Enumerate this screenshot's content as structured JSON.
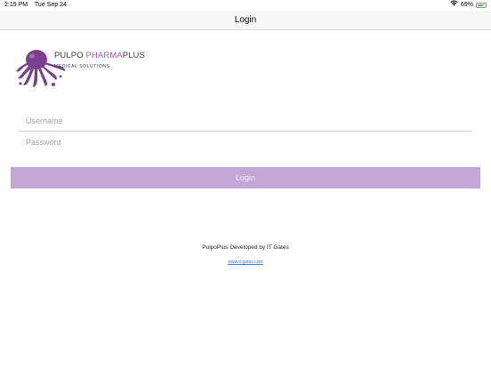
{
  "status_bar": {
    "time": "2:19 PM",
    "date": "Tue Sep 24",
    "battery_percent_label": "69%",
    "battery_level": 0.69,
    "wifi_icon": "wifi-icon",
    "battery_icon": "battery-icon"
  },
  "nav": {
    "title": "Login"
  },
  "logo": {
    "icon": "octopus-logo",
    "brand_part1": "PULPO ",
    "brand_part2": "PHARMA",
    "brand_part3": "PLUS",
    "tagline": "MEDICAL SOLUTIONS",
    "colors": {
      "octopus": "#7b3f8f",
      "accent": "#9b59b6"
    }
  },
  "form": {
    "username_placeholder": "Username",
    "username_value": "",
    "password_placeholder": "Password",
    "password_value": "",
    "login_label": "Login",
    "button_color": "#c4a6d6"
  },
  "footer": {
    "text": "PulpoPlus Developed by IT Gates",
    "link": "www.it-gates.com"
  }
}
